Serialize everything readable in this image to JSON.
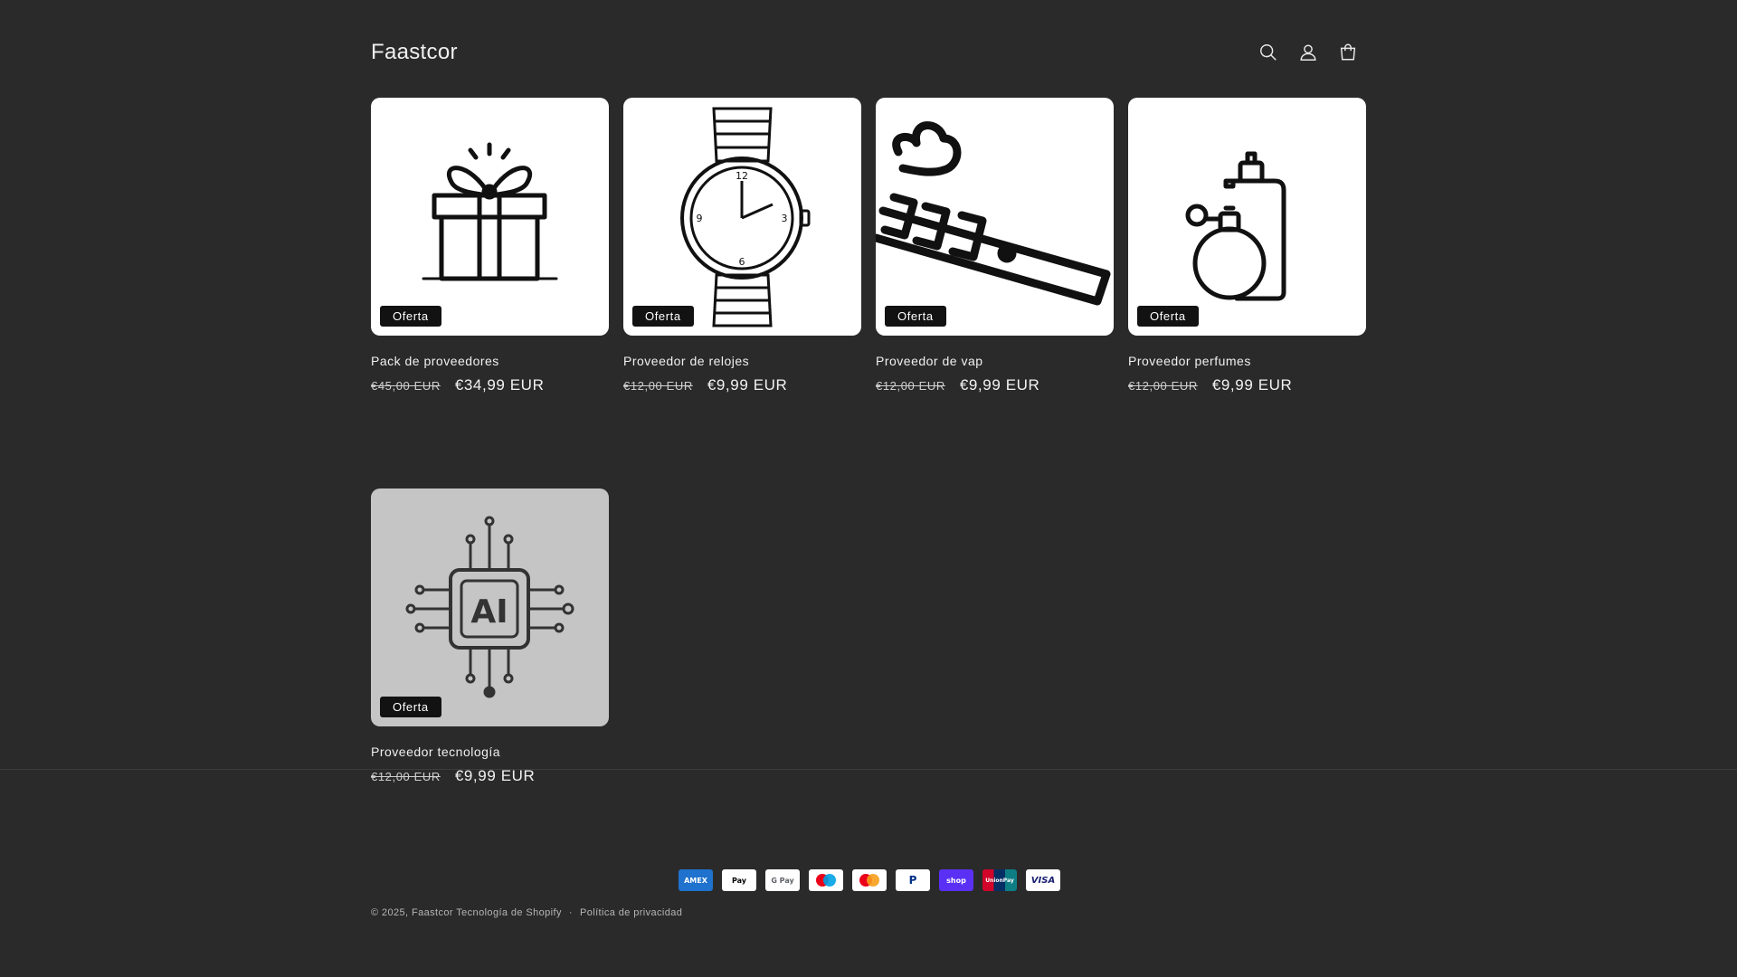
{
  "header": {
    "logo": "Faastcor",
    "icons": [
      "search-icon",
      "account-icon",
      "cart-icon"
    ]
  },
  "products": [
    {
      "title": "Pack de proveedores",
      "badge": "Oferta",
      "price_old": "€45,00 EUR",
      "price_new": "€34,99 EUR",
      "image": "gift-icon"
    },
    {
      "title": "Proveedor de relojes",
      "badge": "Oferta",
      "price_old": "€12,00 EUR",
      "price_new": "€9,99 EUR",
      "image": "watch-icon"
    },
    {
      "title": "Proveedor de vap",
      "badge": "Oferta",
      "price_old": "€12,00 EUR",
      "price_new": "€9,99 EUR",
      "image": "vape-icon"
    },
    {
      "title": "Proveedor perfumes",
      "badge": "Oferta",
      "price_old": "€12,00 EUR",
      "price_new": "€9,99 EUR",
      "image": "perfume-icon"
    },
    {
      "title": "Proveedor tecnología",
      "badge": "Oferta",
      "price_old": "€12,00 EUR",
      "price_new": "€9,99 EUR",
      "image": "ai-chip-icon"
    }
  ],
  "footer": {
    "payments": [
      {
        "name": "American Express",
        "label": "AMEX",
        "color": "#1f72cd"
      },
      {
        "name": "Apple Pay",
        "label": "Pay",
        "color": "#ffffff"
      },
      {
        "name": "Google Pay",
        "label": "G Pay",
        "color": "#ffffff"
      },
      {
        "name": "Maestro",
        "label": "",
        "color": "#ffffff"
      },
      {
        "name": "Mastercard",
        "label": "",
        "color": "#ffffff"
      },
      {
        "name": "PayPal",
        "label": "P",
        "color": "#ffffff"
      },
      {
        "name": "Shop Pay",
        "label": "shop",
        "color": "#5a31f4"
      },
      {
        "name": "UnionPay",
        "label": "UnionPay",
        "color": "#0e7e85"
      },
      {
        "name": "Visa",
        "label": "VISA",
        "color": "#ffffff"
      }
    ],
    "copyright_prefix": "© 2025,",
    "store_link": "Faastcor",
    "powered": "Tecnología de Shopify",
    "separator": "·",
    "privacy": "Política de privacidad"
  }
}
